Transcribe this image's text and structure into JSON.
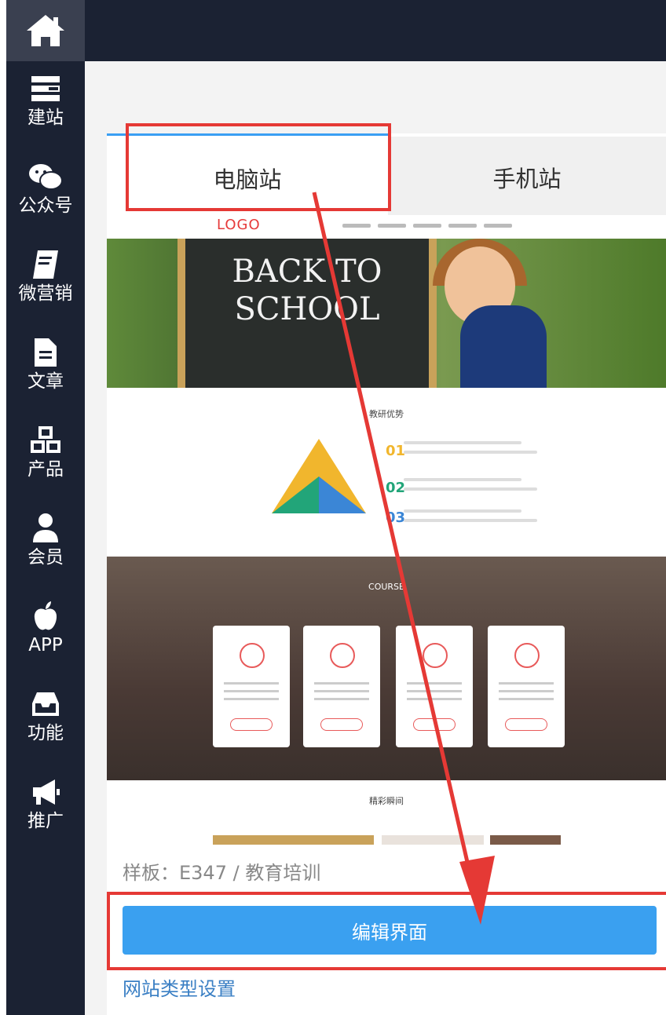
{
  "sidebar": {
    "items": [
      {
        "icon": "layers-icon",
        "label": "建站"
      },
      {
        "icon": "wechat-icon",
        "label": "公众号"
      },
      {
        "icon": "book-icon",
        "label": "微营销"
      },
      {
        "icon": "document-icon",
        "label": "文章"
      },
      {
        "icon": "cubes-icon",
        "label": "产品"
      },
      {
        "icon": "user-icon",
        "label": "会员"
      },
      {
        "icon": "apple-icon",
        "label": "APP"
      },
      {
        "icon": "inbox-icon",
        "label": "功能"
      },
      {
        "icon": "megaphone-icon",
        "label": "推广"
      }
    ]
  },
  "tabs": {
    "desktop": "电脑站",
    "mobile": "手机站"
  },
  "preview": {
    "logo": "LOGO",
    "hero_text": "BACK TO SCHOOL",
    "section_title": "教研优势",
    "advantages": [
      "01",
      "02",
      "03"
    ],
    "courses_title": "COURSE",
    "gallery_title": "精彩瞬间"
  },
  "template_label": "样板：E347 / 教育培训",
  "edit_button": "编辑界面",
  "site_type_link": "网站类型设置",
  "colors": {
    "sidebar": "#1b2233",
    "accent": "#3aa0f0",
    "highlight": "#e53935"
  }
}
